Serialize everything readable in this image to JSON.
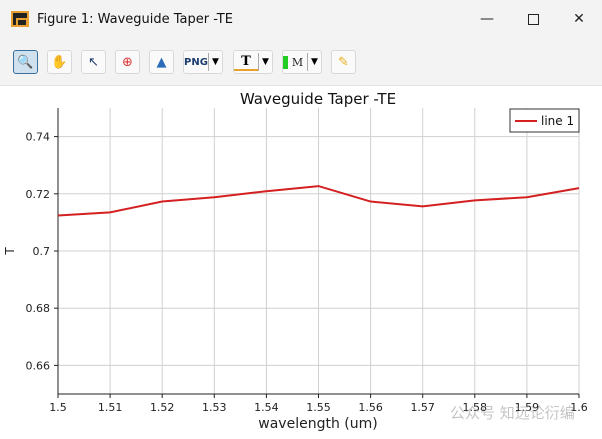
{
  "window": {
    "title": "Figure 1: Waveguide Taper -TE",
    "minimize_icon": "minimize-icon",
    "maximize_icon": "maximize-icon",
    "close_icon": "close-icon"
  },
  "toolbar": {
    "tools": [
      "zoom-icon",
      "pan-hand-icon",
      "select-arrow-icon",
      "zoom-region-icon",
      "mountain-icon",
      "png-export-icon",
      "text-icon",
      "marker-icon",
      "pencil-icon"
    ],
    "png_label": "PNG",
    "text_label": "T",
    "marker_label": "M"
  },
  "watermark": "公众号 知远论衍编",
  "chart_data": {
    "type": "line",
    "title": "Waveguide Taper -TE",
    "xlabel": "wavelength (um)",
    "ylabel": "T",
    "xlim": [
      1.5,
      1.6
    ],
    "ylim": [
      0.65,
      0.75
    ],
    "xticks": [
      "1.5",
      "1.51",
      "1.52",
      "1.53",
      "1.54",
      "1.55",
      "1.56",
      "1.57",
      "1.58",
      "1.59",
      "1.6"
    ],
    "yticks": [
      "0.66",
      "0.68",
      "0.7",
      "0.72",
      "0.74"
    ],
    "grid": true,
    "legend": "top-right",
    "series": [
      {
        "name": "line 1",
        "color": "#d42020",
        "x": [
          1.5,
          1.51,
          1.52,
          1.53,
          1.54,
          1.55,
          1.56,
          1.57,
          1.58,
          1.59,
          1.6
        ],
        "values": [
          0.7124,
          0.7135,
          0.7173,
          0.7188,
          0.7209,
          0.7227,
          0.7173,
          0.7156,
          0.7177,
          0.7188,
          0.722
        ]
      }
    ]
  }
}
